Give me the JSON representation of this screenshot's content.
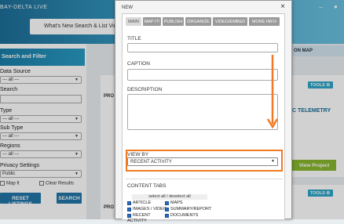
{
  "site": {
    "brand": "BAY-DELTA LIVE",
    "nav": [
      "What's New",
      "Search & List View"
    ]
  },
  "sidebar": {
    "heading": "Search and Filter",
    "data_source_label": "Data Source",
    "data_source_value": "--- all ---",
    "search_label": "Search",
    "type_label": "Type",
    "type_value": "--- all ---",
    "subtype_label": "Sub Type",
    "subtype_value": "--- all ---",
    "regions_label": "Regions",
    "regions_value": "--- all ---",
    "privacy_label": "Privacy Settings",
    "privacy_value": "Public",
    "map_it_label": "Map It",
    "clear_results_label": "Clear Results",
    "reset_button": "RESET LISTINGS",
    "search_button": "SEARCH"
  },
  "main": {
    "on_map_tab": "ON MAP",
    "card_prefix_1": "PRO",
    "card_prefix_2": "PRO",
    "tools_label": "TOOLS",
    "telemetry_title": "C TELEMETRY",
    "view_project_button": "View Project"
  },
  "modal": {
    "title": "NEW",
    "close_glyph": "×",
    "tabs": [
      "MAIN",
      "MAP IT!",
      "PUBLISH",
      "ORGANIZE",
      "VIDEO/EMBED",
      "MORE INFO"
    ],
    "title_label": "TITLE",
    "caption_label": "CAPTION",
    "description_label": "DESCRIPTION",
    "view_by_label": "VIEW BY",
    "view_by_value": "RECENT ACTIVITY",
    "content_tabs_label": "CONTENT TABS",
    "select_all_label": "select all / deselect all",
    "content_tabs": [
      {
        "label": "ARTICLE",
        "checked": true
      },
      {
        "label": "MAPS",
        "checked": true
      },
      {
        "label": "IMAGES / VIDEO",
        "checked": true
      },
      {
        "label": "SUMMARY/REPORT",
        "checked": true
      },
      {
        "label": "RECENT ACTIVITY",
        "checked": true
      },
      {
        "label": "DOCUMENTS",
        "checked": true
      }
    ]
  },
  "colors": {
    "highlight": "#f07a22",
    "header_blue": "#2176a8",
    "view_project_green": "#88b82e"
  }
}
